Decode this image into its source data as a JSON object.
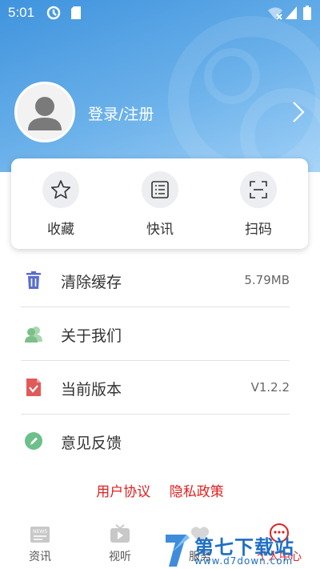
{
  "status_bar": {
    "time": "5:01"
  },
  "profile": {
    "login_label": "登录/注册"
  },
  "quick_actions": [
    {
      "label": "收藏",
      "icon": "star-icon"
    },
    {
      "label": "快讯",
      "icon": "list-icon"
    },
    {
      "label": "扫码",
      "icon": "scan-icon"
    }
  ],
  "menu": {
    "items": [
      {
        "label": "清除缓存",
        "value": "5.79MB",
        "icon": "trash-icon",
        "color": "#5b6ccf"
      },
      {
        "label": "关于我们",
        "value": "",
        "icon": "users-icon",
        "color": "#7cc089"
      },
      {
        "label": "当前版本",
        "value": "V1.2.2",
        "icon": "document-icon",
        "color": "#e05a5a"
      },
      {
        "label": "意见反馈",
        "value": "",
        "icon": "pencil-icon",
        "color": "#6cc08a"
      }
    ]
  },
  "footer_links": {
    "agreement": "用户协议",
    "privacy": "隐私政策"
  },
  "tabbar": {
    "tabs": [
      {
        "label": "资讯",
        "icon": "news-icon"
      },
      {
        "label": "视听",
        "icon": "tv-icon"
      },
      {
        "label": "服务",
        "icon": "heart-icon"
      },
      {
        "label": "个人中心",
        "icon": "profile-icon",
        "active": true
      }
    ]
  },
  "watermark": {
    "name": "第七下载站",
    "url": "www.d7down.com"
  },
  "colors": {
    "header": "#4a9be0",
    "accent_red": "#e02020"
  }
}
